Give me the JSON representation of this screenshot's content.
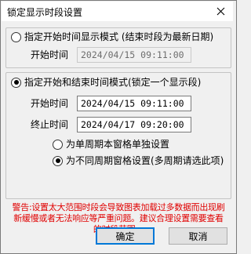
{
  "dialog": {
    "title": "锁定显示时段设置",
    "close_glyph": "✕"
  },
  "mode_latest": {
    "label": "指定开始时间显示模式 (结束时段为最新日期)",
    "selected": false,
    "start_label": "开始时间",
    "start_value": "2024/04/15 09:11:00"
  },
  "mode_range": {
    "label": "指定开始和结束时间模式(锁定一个显示段)",
    "selected": true,
    "start_label": "开始时间",
    "start_value": "2024/04/15 09:11:00",
    "end_label": "终止时间",
    "end_value": "2024/04/17 09:20:00",
    "sub_options": [
      {
        "label": "为单周期本窗格单独设置",
        "selected": false
      },
      {
        "label": "为不同周期窗格设置(多周期请选此项)",
        "selected": true
      }
    ]
  },
  "warning": "警告:设置太大范围时段会导致图表加载过多数据而出现刷新缓慢或者无法响应等严重问题。建议合理设置需要查看的时段范围。",
  "buttons": {
    "ok": "确定",
    "cancel": "取消"
  },
  "colors": {
    "warning": "#e00000",
    "disabled_text": "#6d6d6d",
    "focus": "#0078d7"
  }
}
